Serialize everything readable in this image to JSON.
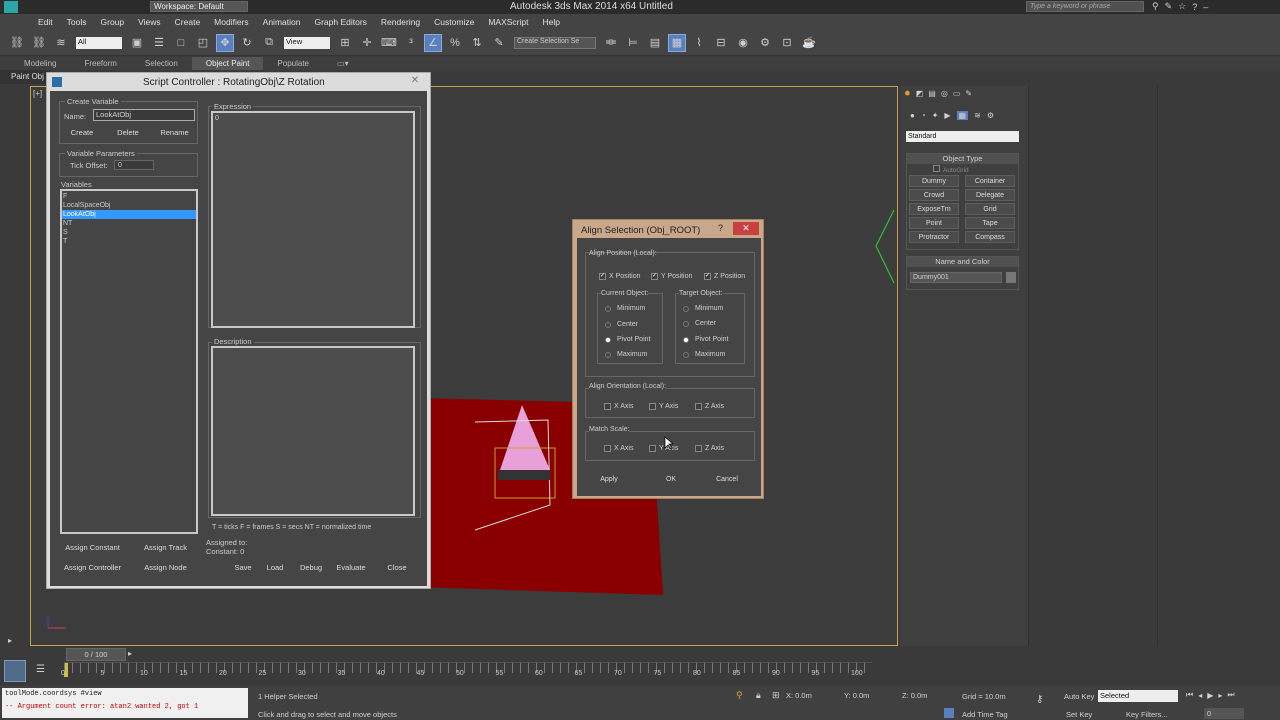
{
  "app": {
    "workspace": "Workspace: Default",
    "title": "Autodesk 3ds Max  2014 x64      Untitled",
    "search_placeholder": "Type a keyword or phrase"
  },
  "menu": [
    "Edit",
    "Tools",
    "Group",
    "Views",
    "Create",
    "Modifiers",
    "Animation",
    "Graph Editors",
    "Rendering",
    "Customize",
    "MAXScript",
    "Help"
  ],
  "toolbar": {
    "filter": "All",
    "refcoord": "View",
    "selset": "Create Selection Se"
  },
  "ribbon": {
    "tabs": [
      "Modeling",
      "Freeform",
      "Selection",
      "Object Paint",
      "Populate"
    ],
    "sub": "Paint Obj"
  },
  "viewport": {
    "label": "[+]"
  },
  "script": {
    "title": "Script Controller : RotatingObj\\Z Rotation",
    "create_variable": "Create Variable",
    "name_label": "Name:",
    "name_value": "LookAtObj",
    "create": "Create",
    "delete": "Delete",
    "rename": "Rename",
    "var_params": "Variable Parameters",
    "tick_offset": "Tick Offset:",
    "tick_value": "0",
    "variables_label": "Variables",
    "variables": [
      "F",
      "LocalSpaceObj",
      "LookAtObj",
      "NT",
      "S",
      "T"
    ],
    "selected_variable": 2,
    "expression_label": "Expression",
    "expression": "0",
    "description_label": "Description",
    "legend": "T = ticks      F = frames      S = secs      NT = normalized time",
    "assigned_to": "Assigned to:",
    "constant": "Constant: 0",
    "assign_constant": "Assign Constant",
    "assign_track": "Assign Track",
    "assign_controller": "Assign Controller",
    "assign_node": "Assign Node",
    "save": "Save",
    "load": "Load",
    "debug": "Debug",
    "evaluate": "Evaluate",
    "close": "Close"
  },
  "align": {
    "title": "Align Selection (Obj_ROOT)",
    "help": "?",
    "pos_group": "Align Position (Local):",
    "xpos": "X Position",
    "ypos": "Y Position",
    "zpos": "Z Position",
    "current": "Current Object:",
    "target": "Target Object:",
    "options": [
      "Minimum",
      "Center",
      "Pivot Point",
      "Maximum"
    ],
    "orient_group": "Align Orientation (Local):",
    "scale_group": "Match Scale:",
    "xaxis": "X Axis",
    "yaxis": "Y Axis",
    "zaxis": "Z Axis",
    "apply": "Apply",
    "ok": "OK",
    "cancel": "Cancel"
  },
  "command": {
    "dropdown": "Standard",
    "object_type": "Object Type",
    "autogrid": "AutoGrid",
    "buttons": [
      "Dummy",
      "Container",
      "Crowd",
      "Delegate",
      "ExposeTm",
      "Grid",
      "Point",
      "Tape",
      "Protractor",
      "Compass"
    ],
    "name_color": "Name and Color",
    "name_value": "Dummy001"
  },
  "timeline": {
    "frame": "0 / 100",
    "ticks": [
      "0",
      "5",
      "10",
      "15",
      "20",
      "25",
      "30",
      "35",
      "40",
      "45",
      "50",
      "55",
      "60",
      "65",
      "70",
      "75",
      "80",
      "85",
      "90",
      "95",
      "100"
    ]
  },
  "status": {
    "script_line1": "toolMode.coordsys #view",
    "script_line2": "-- Argument count error: atan2 wanted 2, got 1",
    "selected": "1 Helper Selected",
    "prompt": "Click and drag to select and move objects",
    "x": "X: 0.0m",
    "y": "Y: 0.0m",
    "z": "Z: 0.0m",
    "grid": "Grid = 10.0m",
    "add_time_tag": "Add Time Tag",
    "auto_key": "Auto Key",
    "set_key": "Set Key",
    "selected_dd": "Selected",
    "key_filters": "Key Filters...",
    "frame_value": "0"
  }
}
